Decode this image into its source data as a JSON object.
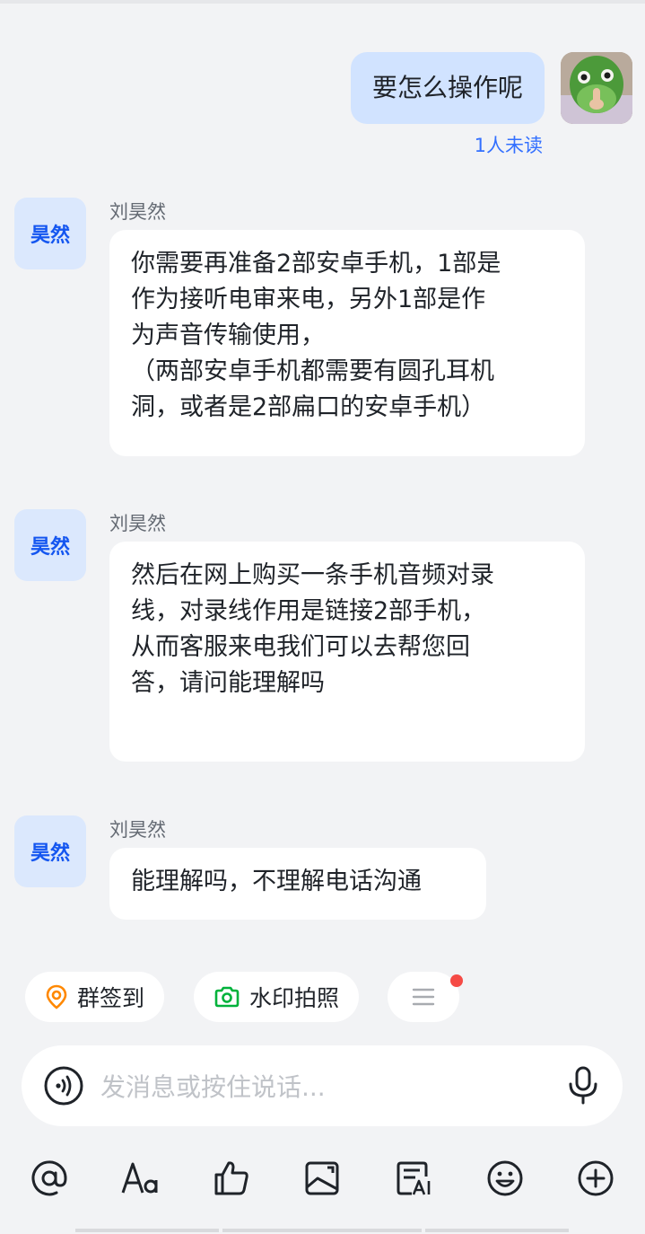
{
  "outgoing": {
    "text": "要怎么操作呢",
    "read_status": "1人未读"
  },
  "messages": [
    {
      "sender": "刘昊然",
      "avatar_text": "昊然",
      "lines": [
        "你需要再准备2部安卓手机，1部是",
        "作为接听电审来电，另外1部是作",
        "为声音传输使用，",
        "（两部安卓手机都需要有圆孔耳机",
        "洞，或者是2部扁口的安卓手机）"
      ]
    },
    {
      "sender": "刘昊然",
      "avatar_text": "昊然",
      "lines": [
        "然后在网上购买一条手机音频对录",
        "线，对录线作用是链接2部手机，",
        "从而客服来电我们可以去帮您回",
        "答，请问能理解吗"
      ]
    },
    {
      "sender": "刘昊然",
      "avatar_text": "昊然",
      "lines": [
        "能理解吗，不理解电话沟通"
      ]
    }
  ],
  "quick_actions": {
    "checkin": {
      "label": "群签到",
      "icon": "location-pin-icon",
      "color": "#ff8800"
    },
    "photo": {
      "label": "水印拍照",
      "icon": "camera-icon",
      "color": "#00b23b"
    },
    "more": {
      "icon": "menu-icon"
    }
  },
  "input": {
    "placeholder": "发消息或按住说话..."
  },
  "toolbar": [
    {
      "icon": "at-icon"
    },
    {
      "icon": "text-format-icon"
    },
    {
      "icon": "thumbs-up-icon"
    },
    {
      "icon": "image-icon"
    },
    {
      "icon": "ai-document-icon"
    },
    {
      "icon": "emoji-icon"
    },
    {
      "icon": "plus-circle-icon"
    }
  ],
  "colors": {
    "accent": "#3370ff",
    "outgoing_bubble": "#d1e3ff",
    "avatar_bg": "#dbe8fd",
    "unread_dot": "#f54a45"
  }
}
